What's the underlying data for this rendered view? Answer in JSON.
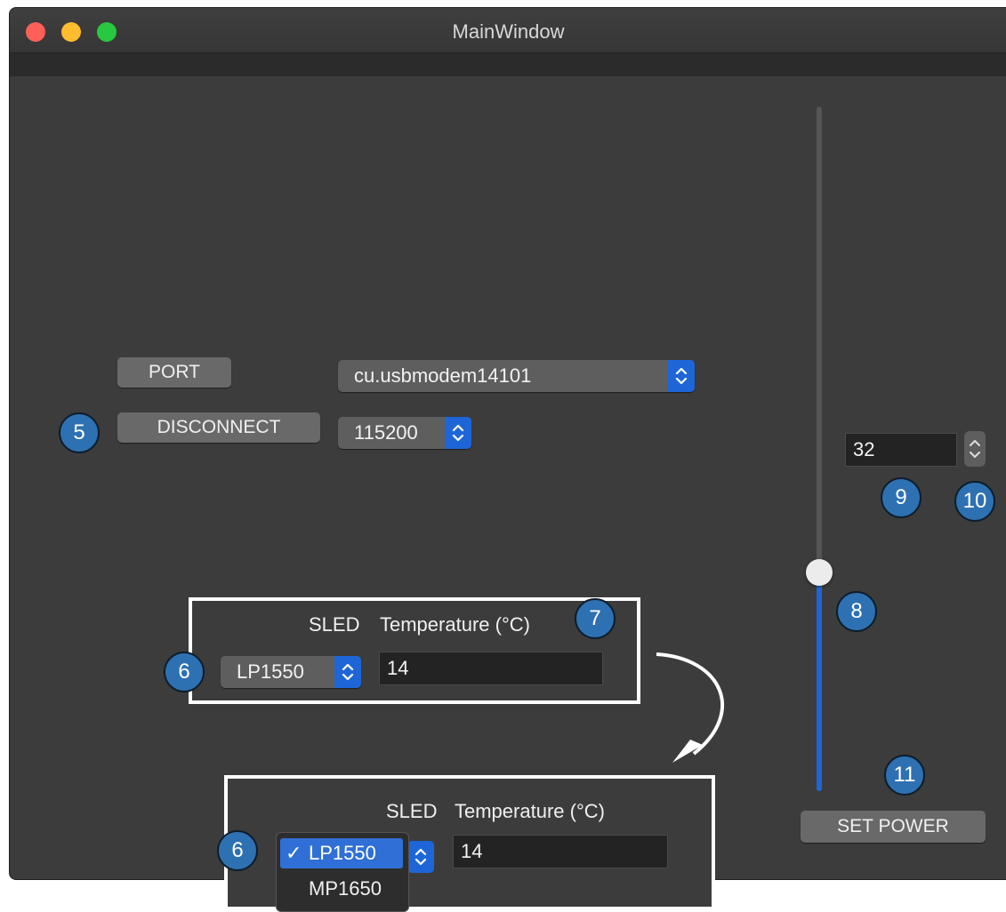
{
  "window": {
    "title": "MainWindow"
  },
  "connection": {
    "port_button": "PORT",
    "disconnect_button": "DISCONNECT",
    "port_value": "cu.usbmodem14101",
    "baud_value": "115200"
  },
  "sled_panel": {
    "sled_label": "SLED",
    "temperature_label": "Temperature (°C)",
    "sled_value": "LP1550",
    "temperature_value": "14"
  },
  "sled_panel_expanded": {
    "sled_label": "SLED",
    "temperature_label": "Temperature (°C)",
    "temperature_value": "14",
    "dropdown_options": [
      "LP1550",
      "MP1650"
    ],
    "selected_option": "LP1550",
    "checkmark": "✓"
  },
  "power": {
    "value": "32",
    "set_power_button": "SET POWER",
    "slider_level_fraction": 0.32
  },
  "badges": [
    "5",
    "6",
    "7",
    "8",
    "9",
    "10",
    "11",
    "6"
  ],
  "colors": {
    "accent": "#1e66d8",
    "badge": "#2e71b2",
    "window_bg": "#3c3c3c"
  },
  "icons": [
    "close-icon",
    "minimize-icon",
    "maximize-icon",
    "chevron-updown-icon",
    "arrow-icon"
  ]
}
